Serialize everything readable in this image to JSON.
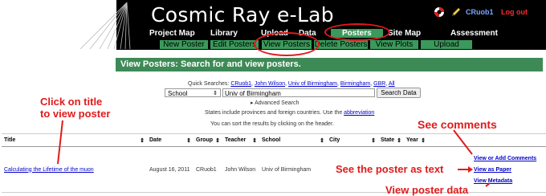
{
  "header": {
    "site_title": "Cosmic Ray e-Lab",
    "user": "CRuob1",
    "logout": "Log out",
    "help_icon": "lifebuoy-icon",
    "notes_icon": "pencil-icon",
    "nav_primary": [
      "Project Map",
      "Library",
      "Upload",
      "Data",
      "Posters",
      "Site Map",
      "Assessment"
    ],
    "nav_secondary": [
      "New Poster",
      "Edit Posters",
      "View Posters",
      "Delete Posters",
      "View Plots",
      "Upload"
    ],
    "colors": {
      "nav_green": "#3b9a5b",
      "annotation_red": "#e01b1b"
    }
  },
  "page": {
    "banner": "View Posters: Search for and view posters.",
    "quick_searches_label": "Quick Searches:",
    "quick_searches": [
      "CRuob1",
      "John Wilson",
      "Univ of Birmingham",
      "Birmingham",
      "GBR",
      "All"
    ],
    "search_field_select": "School",
    "search_value": "Univ of Birmingham",
    "search_button": "Search Data",
    "advanced_search": "▸ Advanced Search",
    "states_note_prefix": "States include provinces and foreign countries. Use the",
    "states_note_link": "abbreviation",
    "sort_note": "You can sort the results by clicking on the header."
  },
  "table": {
    "columns": [
      "Title",
      "Date",
      "Group",
      "Teacher",
      "School",
      "City",
      "State",
      "Year"
    ],
    "rows": [
      {
        "title": "Calculating the Lifetime of the muon",
        "date": "August 16, 2011",
        "group": "CRuob1",
        "teacher": "John Wilson",
        "school": "Univ of Birmingham"
      }
    ],
    "actions": [
      "View or Add Comments",
      "View as Paper",
      "View Metadata"
    ]
  },
  "annotations": {
    "click_title": "Click on title",
    "click_title_2": "to view poster",
    "see_comments": "See comments",
    "see_text": "See the poster as text",
    "view_data": "View poster data"
  }
}
